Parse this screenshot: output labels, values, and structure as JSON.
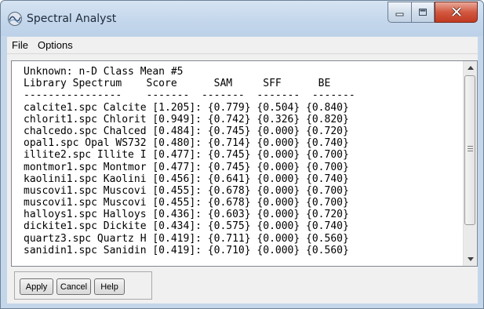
{
  "window": {
    "title": "Spectral Analyst"
  },
  "menu": [
    {
      "label": "File"
    },
    {
      "label": "Options"
    }
  ],
  "report": {
    "lines": [
      "Unknown: n-D Class Mean #5",
      "Library Spectrum    Score      SAM     SFF      BE",
      "----------------    -------  -------  -------  -------",
      "calcite1.spc Calcite [1.205]: {0.779} {0.504} {0.840}",
      "chlorit1.spc Chlorit [0.949]: {0.742} {0.326} {0.820}",
      "chalcedo.spc Chalced [0.484]: {0.745} {0.000} {0.720}",
      "opal1.spc Opal WS732 [0.480]: {0.714} {0.000} {0.740}",
      "illite2.spc Illite I [0.477]: {0.745} {0.000} {0.700}",
      "montmor1.spc Montmor [0.477]: {0.745} {0.000} {0.700}",
      "kaolini1.spc Kaolini [0.456]: {0.641} {0.000} {0.740}",
      "muscovi1.spc Muscovi [0.455]: {0.678} {0.000} {0.700}",
      "muscovi1.spc Muscovi [0.455]: {0.678} {0.000} {0.700}",
      "halloys1.spc Halloys [0.436]: {0.603} {0.000} {0.720}",
      "dickite1.spc Dickite [0.434]: {0.575} {0.000} {0.740}",
      "quartz3.spc Quartz H [0.419]: {0.711} {0.000} {0.560}",
      "sanidin1.spc Sanidin [0.419]: {0.710} {0.000} {0.560}"
    ]
  },
  "buttons": {
    "apply": "Apply",
    "cancel": "Cancel",
    "help": "Help"
  },
  "icons": {
    "app": "spectral-analyst-icon",
    "minimize": "minimize-icon",
    "maximize": "maximize-icon",
    "close": "close-icon",
    "scroll_up": "arrow-up-icon",
    "scroll_down": "arrow-down-icon"
  },
  "colors": {
    "close_button": "#c13a21",
    "title_bar": "#c4d6ea"
  }
}
